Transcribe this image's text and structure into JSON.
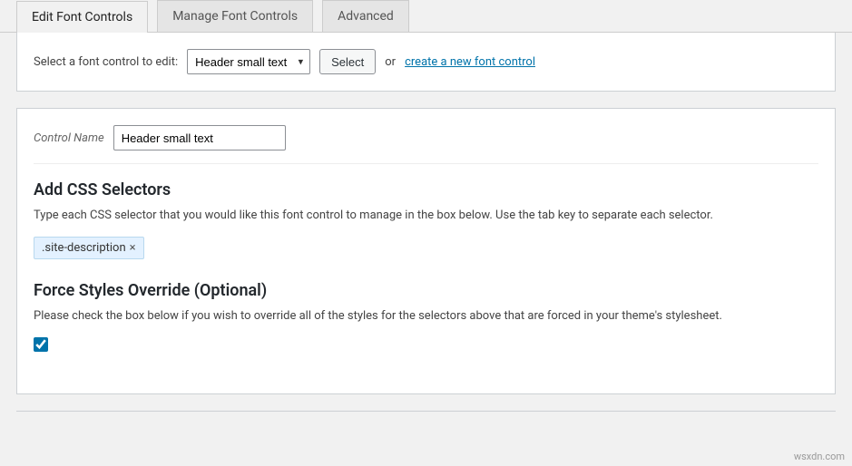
{
  "tabs": {
    "edit": "Edit Font Controls",
    "manage": "Manage Font Controls",
    "advanced": "Advanced"
  },
  "selector": {
    "label": "Select a font control to edit:",
    "selected": "Header small text",
    "select_btn": "Select",
    "or": "or",
    "create_link": "create a new font control"
  },
  "control_name": {
    "label": "Control Name",
    "value": "Header small text"
  },
  "css_selectors": {
    "title": "Add CSS Selectors",
    "desc": "Type each CSS selector that you would like this font control to manage in the box below. Use the tab key to separate each selector.",
    "tags": [
      ".site-description"
    ]
  },
  "force_override": {
    "title": "Force Styles Override (Optional)",
    "desc": "Please check the box below if you wish to override all of the styles for the selectors above that are forced in your theme's stylesheet.",
    "checked": true
  },
  "watermark": "wsxdn.com"
}
